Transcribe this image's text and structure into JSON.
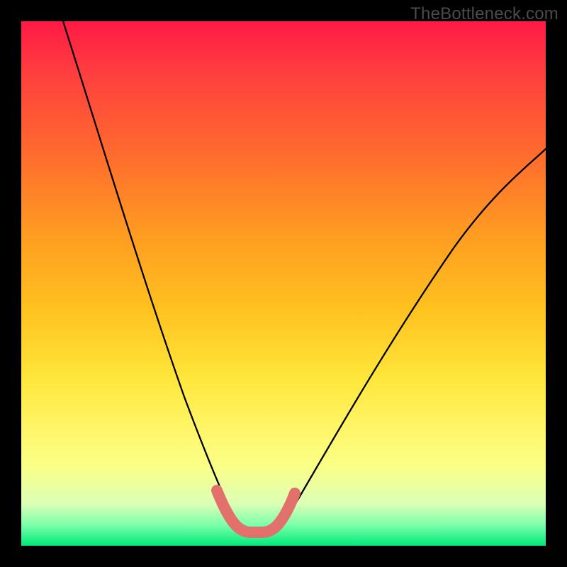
{
  "watermark": {
    "text": "TheBottleneck.com"
  },
  "chart_data": {
    "type": "line",
    "title": "",
    "xlabel": "",
    "ylabel": "",
    "xlim": [
      0,
      100
    ],
    "ylim": [
      0,
      100
    ],
    "description": "Bottleneck percentage curve over a rainbow performance gradient. V-shaped black curve with salmon highlight at the valley.",
    "gradient_stops": [
      {
        "pct": 0,
        "color": "#ff1a45"
      },
      {
        "pct": 10,
        "color": "#ff3f3f"
      },
      {
        "pct": 25,
        "color": "#ff6a2e"
      },
      {
        "pct": 40,
        "color": "#ff9a22"
      },
      {
        "pct": 55,
        "color": "#ffc21f"
      },
      {
        "pct": 68,
        "color": "#ffe63a"
      },
      {
        "pct": 78,
        "color": "#fff66a"
      },
      {
        "pct": 85,
        "color": "#faff87"
      },
      {
        "pct": 92,
        "color": "#dcffb6"
      },
      {
        "pct": 96,
        "color": "#7cffab"
      },
      {
        "pct": 100,
        "color": "#00e97a"
      }
    ],
    "series": [
      {
        "name": "bottleneck-curve-left",
        "x": [
          8,
          12,
          16,
          20,
          24,
          28,
          32,
          35,
          37,
          39,
          40,
          41,
          42
        ],
        "values": [
          100,
          86,
          72,
          59,
          47,
          35,
          25,
          16,
          10,
          6,
          4,
          3,
          3
        ]
      },
      {
        "name": "bottleneck-curve-right",
        "x": [
          46,
          48,
          50,
          53,
          57,
          62,
          68,
          75,
          83,
          92,
          100
        ],
        "values": [
          3,
          4,
          6,
          10,
          17,
          26,
          36,
          47,
          58,
          68,
          76
        ]
      },
      {
        "name": "valley-highlight",
        "x": [
          37,
          38,
          39,
          40,
          41,
          42,
          43,
          44,
          45,
          46,
          47,
          48,
          49,
          50
        ],
        "values": [
          10.5,
          7.5,
          5.5,
          4,
          3.2,
          3,
          3,
          3,
          3,
          3.2,
          4,
          5,
          7,
          9.5
        ]
      }
    ],
    "valley": {
      "x_range": [
        40,
        47
      ],
      "y": 3
    },
    "highlight_color": "#e2716b",
    "curve_color": "#000000"
  }
}
